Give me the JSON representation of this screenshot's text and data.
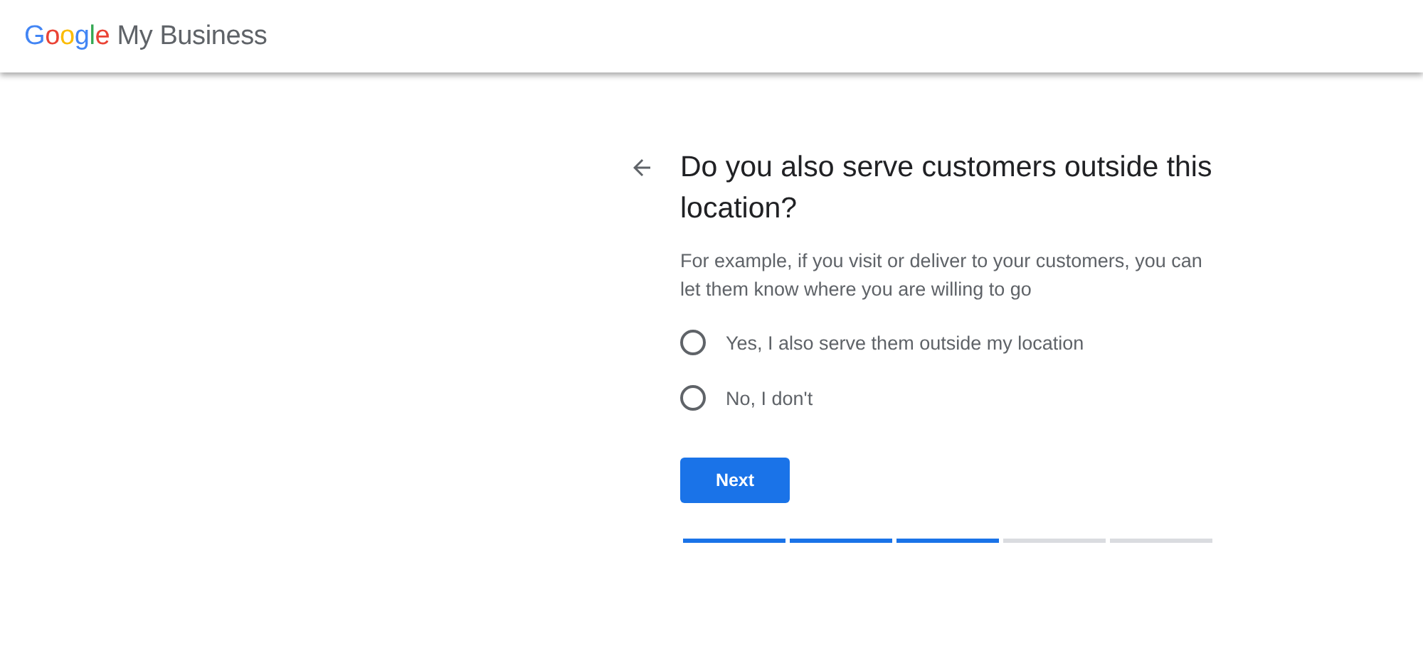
{
  "header": {
    "logo_brand": "Google",
    "logo_product": "My Business"
  },
  "question": {
    "title": "Do you also serve customers outside this location?",
    "description": "For example, if you visit or deliver to your customers, you can let them know where you are willing to go"
  },
  "options": [
    {
      "label": "Yes, I also serve them outside my location",
      "selected": false
    },
    {
      "label": "No, I don't",
      "selected": false
    }
  ],
  "next_button": "Next",
  "progress_steps": [
    {
      "done": true
    },
    {
      "done": true
    },
    {
      "done": true
    },
    {
      "done": false
    },
    {
      "done": false
    }
  ]
}
